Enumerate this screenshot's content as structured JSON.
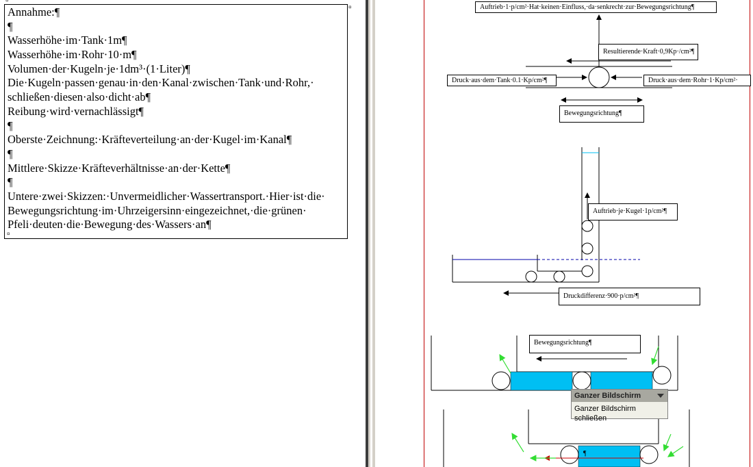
{
  "document": {
    "notes_lines": [
      "Annahme:¶",
      "¶",
      "Wasserhöhe·im·Tank·1m¶",
      "Wasserhöhe·im·Rohr·10·m¶",
      "Volumen·der·Kugeln·je·1dm³·(1·Liter)¶",
      "Die·Kugeln·passen·genau·in·den·Kanal·zwischen·Tank·und·Rohr,·",
      "schließen·diesen·also·dicht·ab¶",
      "Reibung·wird·vernachlässigt¶",
      "¶",
      "Oberste·Zeichnung:·Kräfteverteilung·an·der·Kugel·im·Kanal¶",
      "¶",
      "Mittlere·Skizze·Kräfteverhältnisse·an·der·Kette¶",
      "¶",
      "Untere·zwei·Skizzen:·Unvermeidlicher·Wassertransport.·Hier·ist·die·",
      "Bewegungsrichtung·im·Uhrzeigersinn·eingezeichnet,·die·grünen·",
      "Pfeli·deuten·die·Bewegung·des·Wassers·an¶"
    ],
    "cell_mark": "¤"
  },
  "diagram": {
    "auftrieb_top": "Auftrieb·1·p/cm²·Hat·keinen·Einfluss,·da·senkrecht·zur·Bewegungsrichtung¶",
    "resultierende": "Resultierende·Kraft·0,9Kp·/cm²¶",
    "druck_tank": "Druck·aus·dem·Tank·0.1·Kp/cm²¶",
    "druck_rohr": "Druck·aus·dem·Rohr·1·Kp/cm²·",
    "bewegung1": "Bewegungsrichtung¶",
    "auftrieb_kugel": "Auftrieb·je·Kugel·1p/cm²¶",
    "druckdifferenz": "Druckdifferenz·900·p/cm²¶",
    "bewegung2": "Bewegungsrichtung¶",
    "pilcrow": "¶"
  },
  "fullscreen_popup": {
    "title": "Ganzer Bildschirm",
    "close_label": "Ganzer Bildschirm schließen"
  },
  "colors": {
    "cyan_fill": "#00bff3",
    "green_arrow": "#33dd33",
    "margin_red": "#c00000",
    "water_line": "#0000aa"
  }
}
